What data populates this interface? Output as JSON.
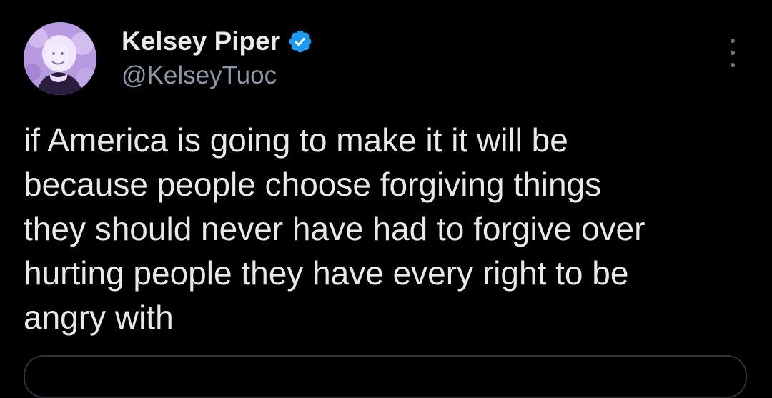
{
  "author": {
    "display_name": "Kelsey Piper",
    "handle": "@KelseyTuoc",
    "verified": true
  },
  "tweet": {
    "text": "if America is going to make it it will be\nbecause people choose forgiving things\nthey should never have had to forgive over\nhurting people they have every right to be\nangry with"
  },
  "icons": {
    "verified": "verified-badge-icon",
    "more": "more-options-icon"
  },
  "colors": {
    "background": "#000000",
    "primary_text": "#e7e9ea",
    "secondary_text": "#8b98a5",
    "verified_blue": "#1d9bf0",
    "avatar_tint": "#a78bd8"
  }
}
